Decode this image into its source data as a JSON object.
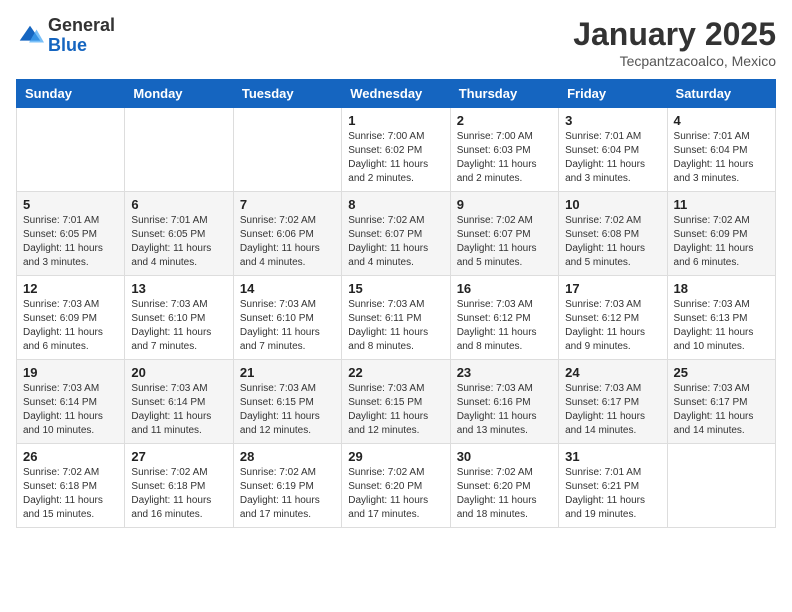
{
  "logo": {
    "general": "General",
    "blue": "Blue"
  },
  "title": "January 2025",
  "location": "Tecpantzacoalco, Mexico",
  "weekdays": [
    "Sunday",
    "Monday",
    "Tuesday",
    "Wednesday",
    "Thursday",
    "Friday",
    "Saturday"
  ],
  "weeks": [
    [
      {
        "day": "",
        "info": ""
      },
      {
        "day": "",
        "info": ""
      },
      {
        "day": "",
        "info": ""
      },
      {
        "day": "1",
        "info": "Sunrise: 7:00 AM\nSunset: 6:02 PM\nDaylight: 11 hours\nand 2 minutes."
      },
      {
        "day": "2",
        "info": "Sunrise: 7:00 AM\nSunset: 6:03 PM\nDaylight: 11 hours\nand 2 minutes."
      },
      {
        "day": "3",
        "info": "Sunrise: 7:01 AM\nSunset: 6:04 PM\nDaylight: 11 hours\nand 3 minutes."
      },
      {
        "day": "4",
        "info": "Sunrise: 7:01 AM\nSunset: 6:04 PM\nDaylight: 11 hours\nand 3 minutes."
      }
    ],
    [
      {
        "day": "5",
        "info": "Sunrise: 7:01 AM\nSunset: 6:05 PM\nDaylight: 11 hours\nand 3 minutes."
      },
      {
        "day": "6",
        "info": "Sunrise: 7:01 AM\nSunset: 6:05 PM\nDaylight: 11 hours\nand 4 minutes."
      },
      {
        "day": "7",
        "info": "Sunrise: 7:02 AM\nSunset: 6:06 PM\nDaylight: 11 hours\nand 4 minutes."
      },
      {
        "day": "8",
        "info": "Sunrise: 7:02 AM\nSunset: 6:07 PM\nDaylight: 11 hours\nand 4 minutes."
      },
      {
        "day": "9",
        "info": "Sunrise: 7:02 AM\nSunset: 6:07 PM\nDaylight: 11 hours\nand 5 minutes."
      },
      {
        "day": "10",
        "info": "Sunrise: 7:02 AM\nSunset: 6:08 PM\nDaylight: 11 hours\nand 5 minutes."
      },
      {
        "day": "11",
        "info": "Sunrise: 7:02 AM\nSunset: 6:09 PM\nDaylight: 11 hours\nand 6 minutes."
      }
    ],
    [
      {
        "day": "12",
        "info": "Sunrise: 7:03 AM\nSunset: 6:09 PM\nDaylight: 11 hours\nand 6 minutes."
      },
      {
        "day": "13",
        "info": "Sunrise: 7:03 AM\nSunset: 6:10 PM\nDaylight: 11 hours\nand 7 minutes."
      },
      {
        "day": "14",
        "info": "Sunrise: 7:03 AM\nSunset: 6:10 PM\nDaylight: 11 hours\nand 7 minutes."
      },
      {
        "day": "15",
        "info": "Sunrise: 7:03 AM\nSunset: 6:11 PM\nDaylight: 11 hours\nand 8 minutes."
      },
      {
        "day": "16",
        "info": "Sunrise: 7:03 AM\nSunset: 6:12 PM\nDaylight: 11 hours\nand 8 minutes."
      },
      {
        "day": "17",
        "info": "Sunrise: 7:03 AM\nSunset: 6:12 PM\nDaylight: 11 hours\nand 9 minutes."
      },
      {
        "day": "18",
        "info": "Sunrise: 7:03 AM\nSunset: 6:13 PM\nDaylight: 11 hours\nand 10 minutes."
      }
    ],
    [
      {
        "day": "19",
        "info": "Sunrise: 7:03 AM\nSunset: 6:14 PM\nDaylight: 11 hours\nand 10 minutes."
      },
      {
        "day": "20",
        "info": "Sunrise: 7:03 AM\nSunset: 6:14 PM\nDaylight: 11 hours\nand 11 minutes."
      },
      {
        "day": "21",
        "info": "Sunrise: 7:03 AM\nSunset: 6:15 PM\nDaylight: 11 hours\nand 12 minutes."
      },
      {
        "day": "22",
        "info": "Sunrise: 7:03 AM\nSunset: 6:15 PM\nDaylight: 11 hours\nand 12 minutes."
      },
      {
        "day": "23",
        "info": "Sunrise: 7:03 AM\nSunset: 6:16 PM\nDaylight: 11 hours\nand 13 minutes."
      },
      {
        "day": "24",
        "info": "Sunrise: 7:03 AM\nSunset: 6:17 PM\nDaylight: 11 hours\nand 14 minutes."
      },
      {
        "day": "25",
        "info": "Sunrise: 7:03 AM\nSunset: 6:17 PM\nDaylight: 11 hours\nand 14 minutes."
      }
    ],
    [
      {
        "day": "26",
        "info": "Sunrise: 7:02 AM\nSunset: 6:18 PM\nDaylight: 11 hours\nand 15 minutes."
      },
      {
        "day": "27",
        "info": "Sunrise: 7:02 AM\nSunset: 6:18 PM\nDaylight: 11 hours\nand 16 minutes."
      },
      {
        "day": "28",
        "info": "Sunrise: 7:02 AM\nSunset: 6:19 PM\nDaylight: 11 hours\nand 17 minutes."
      },
      {
        "day": "29",
        "info": "Sunrise: 7:02 AM\nSunset: 6:20 PM\nDaylight: 11 hours\nand 17 minutes."
      },
      {
        "day": "30",
        "info": "Sunrise: 7:02 AM\nSunset: 6:20 PM\nDaylight: 11 hours\nand 18 minutes."
      },
      {
        "day": "31",
        "info": "Sunrise: 7:01 AM\nSunset: 6:21 PM\nDaylight: 11 hours\nand 19 minutes."
      },
      {
        "day": "",
        "info": ""
      }
    ]
  ]
}
